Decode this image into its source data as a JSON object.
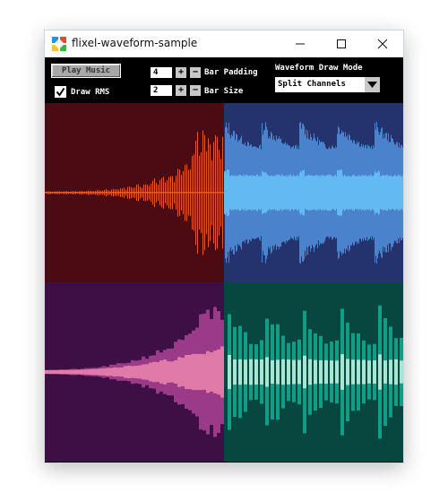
{
  "window": {
    "title": "flixel-waveform-sample",
    "icon": "flixel-logo-icon",
    "controls": [
      "minimize-icon",
      "maximize-icon",
      "close-icon"
    ]
  },
  "toolbar": {
    "play_label": "Play Music",
    "rms_label": "Draw RMS",
    "rms_checked": true,
    "bar_padding": {
      "value": "4",
      "label": "Bar Padding"
    },
    "bar_size": {
      "value": "2",
      "label": "Bar Size"
    },
    "draw_mode": {
      "label": "Waveform Draw Mode",
      "selected": "Split Channels"
    }
  },
  "colors": {
    "q1_bg": "#4a0c12",
    "q1_wave": "#e05a2a",
    "q2_bg": "#24336e",
    "q2_wave": "#4a83cc",
    "q2_rms": "#63b9f2",
    "q3_bg": "#3d0f45",
    "q3_wave": "#9a3a88",
    "q3_rms": "#e07aa8",
    "q4_bg": "#07473f",
    "q4_wave": "#129e86",
    "q4_rms": "#a8e6d4"
  }
}
